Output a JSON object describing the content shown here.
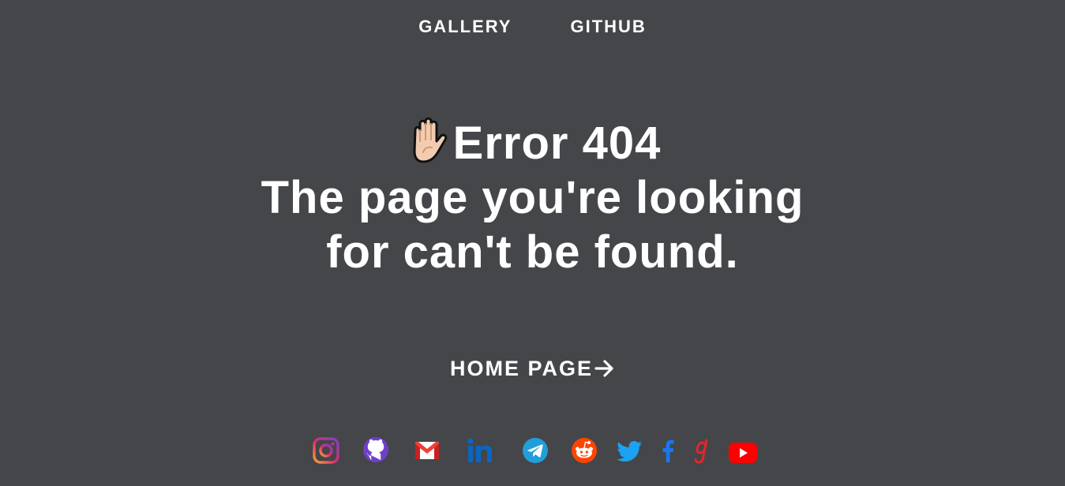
{
  "nav": {
    "items": [
      {
        "label": "GALLERY"
      },
      {
        "label": "GITHUB"
      }
    ]
  },
  "hero": {
    "icon": "raised-hand-icon",
    "line1": "Error 404",
    "line2": "The page you're looking",
    "line3": "for can't be found."
  },
  "home_link": {
    "label": "HOME PAGE",
    "icon": "arrow-right-icon"
  },
  "social": {
    "icons": [
      "instagram-icon",
      "github-icon",
      "gmail-icon",
      "linkedin-icon",
      "telegram-icon",
      "reddit-icon",
      "twitter-icon",
      "facebook-icon",
      "goodreads-icon",
      "youtube-icon"
    ]
  },
  "colors": {
    "background": "#444649",
    "text": "#ffffff",
    "instagram": "#c13584",
    "github": "#6e40c9",
    "gmail": "#ea4335",
    "linkedin": "#0a66c2",
    "telegram": "#229ed9",
    "reddit": "#ff4500",
    "twitter": "#1da1f2",
    "facebook": "#1877f2",
    "goodreads": "#e0262a",
    "youtube": "#ff0000"
  }
}
